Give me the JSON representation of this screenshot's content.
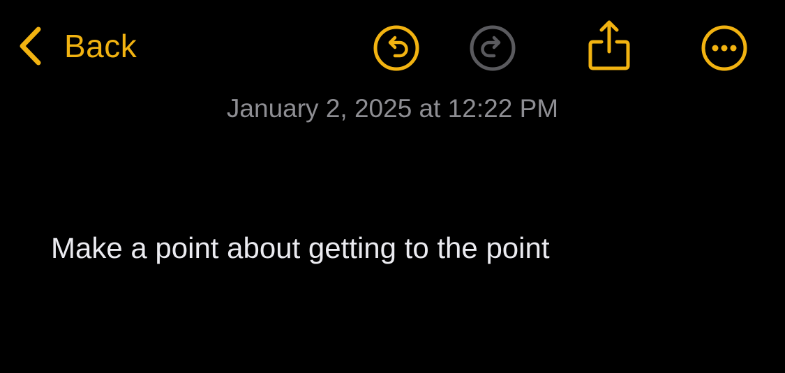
{
  "toolbar": {
    "back_label": "Back",
    "icons": {
      "back": "chevron-left-icon",
      "undo": "undo-circle-icon",
      "redo": "redo-circle-icon",
      "share": "share-icon",
      "more": "ellipsis-circle-icon"
    },
    "redo_enabled": false
  },
  "note": {
    "date": "January 2, 2025 at 12:22 PM",
    "body": "Make a point about getting to the point"
  },
  "colors": {
    "accent": "#F2B311",
    "disabled": "#5A5A5E",
    "background": "#000000",
    "date_text": "#8E8E93",
    "body_text": "#EBEBF0"
  }
}
